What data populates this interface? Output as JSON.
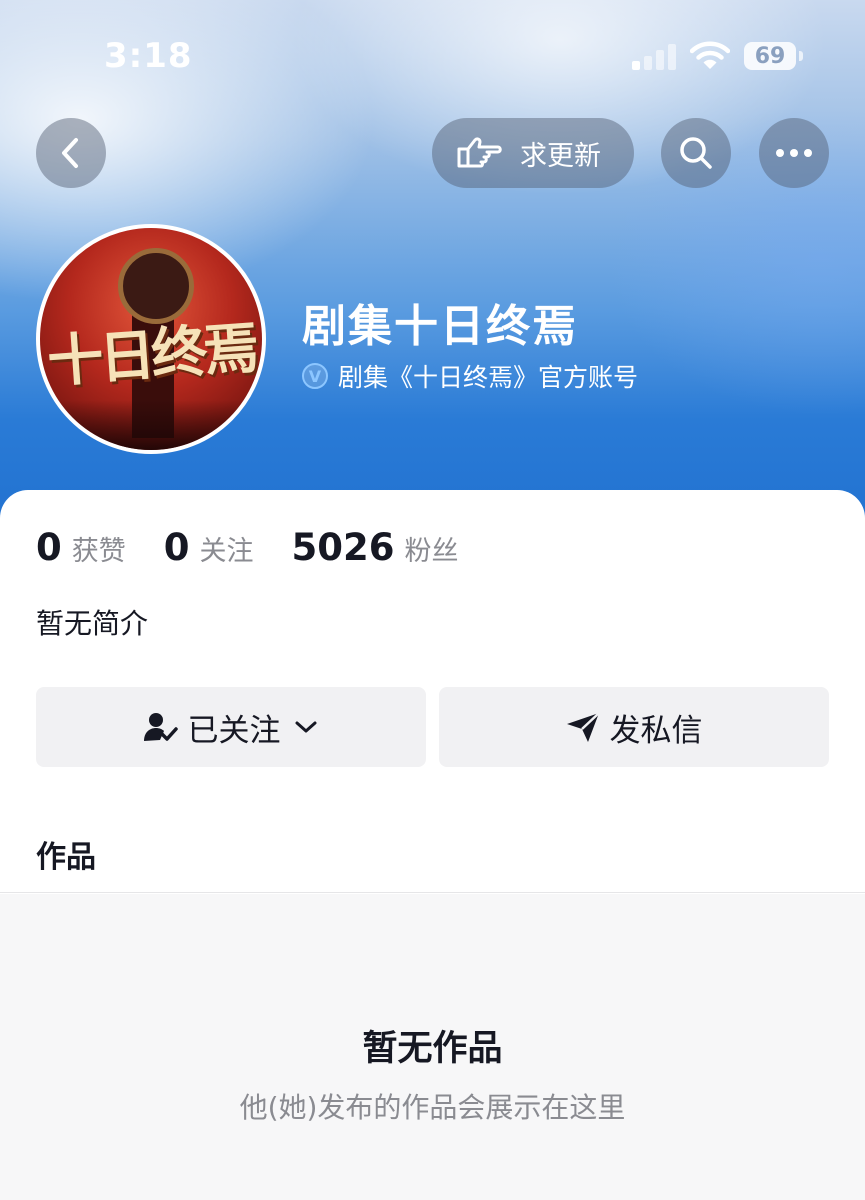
{
  "status_bar": {
    "time": "3:18",
    "battery": "69"
  },
  "nav": {
    "update_label": "求更新"
  },
  "profile": {
    "name": "剧集十日终焉",
    "verified_badge": "V",
    "verified_text": "剧集《十日终焉》官方账号",
    "avatar_text": "十日终焉"
  },
  "stats": [
    {
      "value": "0",
      "label": "获赞"
    },
    {
      "value": "0",
      "label": "关注"
    },
    {
      "value": "5026",
      "label": "粉丝"
    }
  ],
  "bio": "暂无简介",
  "actions": {
    "follow_label": "已关注",
    "message_label": "发私信"
  },
  "works": {
    "title": "作品",
    "empty_title": "暂无作品",
    "empty_subtitle": "他(她)发布的作品会展示在这里"
  },
  "colors": {
    "header_blue": "#2a7bd6",
    "text_primary": "#161823",
    "text_secondary": "#8a8b91",
    "verified": "#8cc6ff"
  }
}
